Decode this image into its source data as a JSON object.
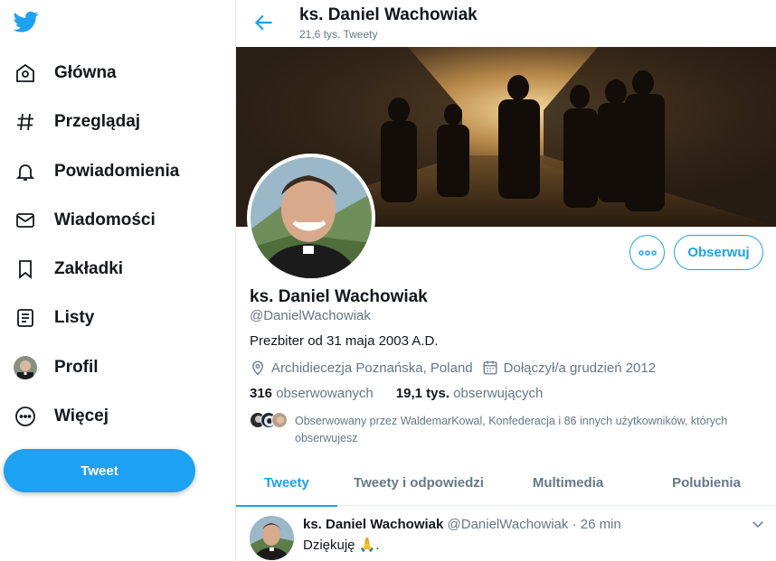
{
  "sidebar": {
    "logo": "twitter-bird-icon",
    "items": [
      {
        "label": "Główna",
        "icon": "home-icon"
      },
      {
        "label": "Przeglądaj",
        "icon": "hashtag-icon"
      },
      {
        "label": "Powiadomienia",
        "icon": "bell-icon"
      },
      {
        "label": "Wiadomości",
        "icon": "envelope-icon"
      },
      {
        "label": "Zakładki",
        "icon": "bookmark-icon"
      },
      {
        "label": "Listy",
        "icon": "list-icon"
      },
      {
        "label": "Profil",
        "icon": "avatar"
      },
      {
        "label": "Więcej",
        "icon": "more-circle-icon"
      }
    ],
    "tweet_button": "Tweet"
  },
  "header": {
    "name": "ks. Daniel Wachowiak",
    "tweet_count": "21,6 tys. Tweety"
  },
  "profile": {
    "name": "ks. Daniel Wachowiak",
    "handle": "@DanielWachowiak",
    "bio": "Prezbiter od 31 maja 2003 A.D.",
    "location": "Archidiecezja Poznańska, Poland",
    "joined": "Dołączył/a grudzień 2012",
    "following_count": "316",
    "following_label": "obserwowanych",
    "followers_count": "19,1 tys.",
    "followers_label": "obserwujących",
    "followed_by": "Obserwowany przez WaldemarKowal, Konfederacja i 86 innych użytkowników, których obserwujesz",
    "follow_button": "Obserwuj"
  },
  "tabs": [
    {
      "label": "Tweety",
      "active": true
    },
    {
      "label": "Tweety i odpowiedzi",
      "active": false
    },
    {
      "label": "Multimedia",
      "active": false
    },
    {
      "label": "Polubienia",
      "active": false
    }
  ],
  "tweet": {
    "name": "ks. Daniel Wachowiak",
    "handle": "@DanielWachowiak",
    "time": "· 26 min",
    "text": "Dziękuję 🙏."
  },
  "colors": {
    "accent": "#1da1f2",
    "text": "#14171a",
    "muted": "#657786",
    "border": "#e6ecf0"
  }
}
